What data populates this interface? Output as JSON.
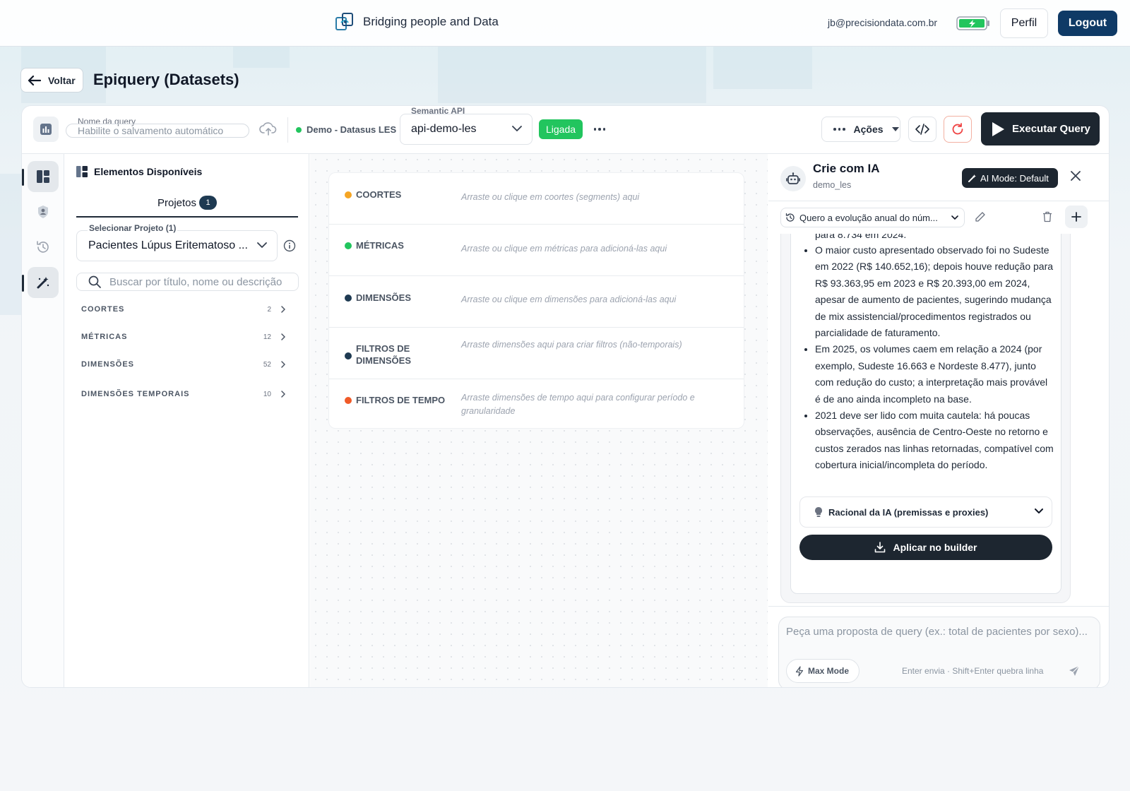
{
  "header": {
    "brand_text": "Bridging people and Data",
    "user_email": "jb@precisiondata.com.br",
    "perfil_label": "Perfil",
    "logout_label": "Logout",
    "battery_color": "#22c55e"
  },
  "title_row": {
    "back_label": "Voltar",
    "page_title": "Epiquery (Datasets)"
  },
  "toolbar": {
    "query_name_label": "Nome da query",
    "query_name_placeholder": "Habilite o salvamento automático",
    "datasource": "Demo - Datasus LES",
    "datasource_status_color": "#22c55e",
    "semantic_api_label": "Semantic API",
    "semantic_api_value": "api-demo-les",
    "connection_badge": "Ligada",
    "acoes_label": "Ações",
    "execute_label": "Executar Query"
  },
  "rail": {
    "items": [
      {
        "icon": "layout-icon",
        "active": true
      },
      {
        "icon": "shield-user-icon",
        "active": false
      },
      {
        "icon": "history-icon",
        "active": false
      },
      {
        "icon": "magic-wand-icon",
        "active": true
      }
    ]
  },
  "elements": {
    "title": "Elementos Disponíveis",
    "tab_label": "Projetos",
    "tab_count": "1",
    "project_select_label": "Selecionar Projeto (1)",
    "project_select_value": "Pacientes Lúpus Eritematoso ...",
    "search_placeholder": "Buscar por título, nome ou descrição",
    "categories": [
      {
        "name": "COORTES",
        "count": "2"
      },
      {
        "name": "MÉTRICAS",
        "count": "12"
      },
      {
        "name": "DIMENSÕES",
        "count": "52"
      },
      {
        "name": "DIMENSÕES TEMPORAIS",
        "count": "10"
      }
    ]
  },
  "builder": {
    "zones": [
      {
        "name": "COORTES",
        "color": "#f5a524",
        "hint": "Arraste ou clique em coortes (segments) aqui"
      },
      {
        "name": "MÉTRICAS",
        "color": "#22c55e",
        "hint": "Arraste ou clique em métricas para adicioná-las aqui"
      },
      {
        "name": "DIMENSÕES",
        "color": "#1e3a52",
        "hint": "Arraste ou clique em dimensões para adicioná-las aqui"
      },
      {
        "name": "FILTROS DE DIMENSÕES",
        "color": "#1e3a52",
        "hint": "Arraste dimensões aqui para criar filtros (não-temporais)"
      },
      {
        "name": "FILTROS DE TEMPO",
        "color": "#f05a28",
        "hint": "Arraste dimensões de tempo aqui para configurar período e granularidade"
      }
    ]
  },
  "ai_panel": {
    "title": "Crie com IA",
    "subtitle": "demo_les",
    "mode_label": "AI Mode: Default",
    "conversation": "Quero a evolução anual do núm...",
    "message_clipped": "para 8.734 em 2024.",
    "bullets": [
      "O maior custo apresentado observado foi no Sudeste em 2022 (R$ 140.652,16); depois houve redução para R$ 93.363,95 em 2023 e R$ 20.393,00 em 2024, apesar de aumento de pacientes, sugerindo mudança de mix assistencial/procedimentos registrados ou parcialidade de faturamento.",
      "Em 2025, os volumes caem em relação a 2024 (por exemplo, Sudeste 16.663 e Nordeste 8.477), junto com redução do custo; a interpretação mais provável é de ano ainda incompleto na base.",
      "2021 deve ser lido com muita cautela: há poucas observações, ausência de Centro-Oeste no retorno e custos zerados nas linhas retornadas, compatível com cobertura inicial/incompleta do período."
    ],
    "rational_label": "Racional da IA (premissas e proxies)",
    "apply_label": "Aplicar no builder",
    "input_placeholder": "Peça uma proposta de query (ex.: total de pacientes por sexo)...",
    "max_mode_label": "Max Mode",
    "enter_hint": "Enter envia · Shift+Enter quebra linha"
  }
}
